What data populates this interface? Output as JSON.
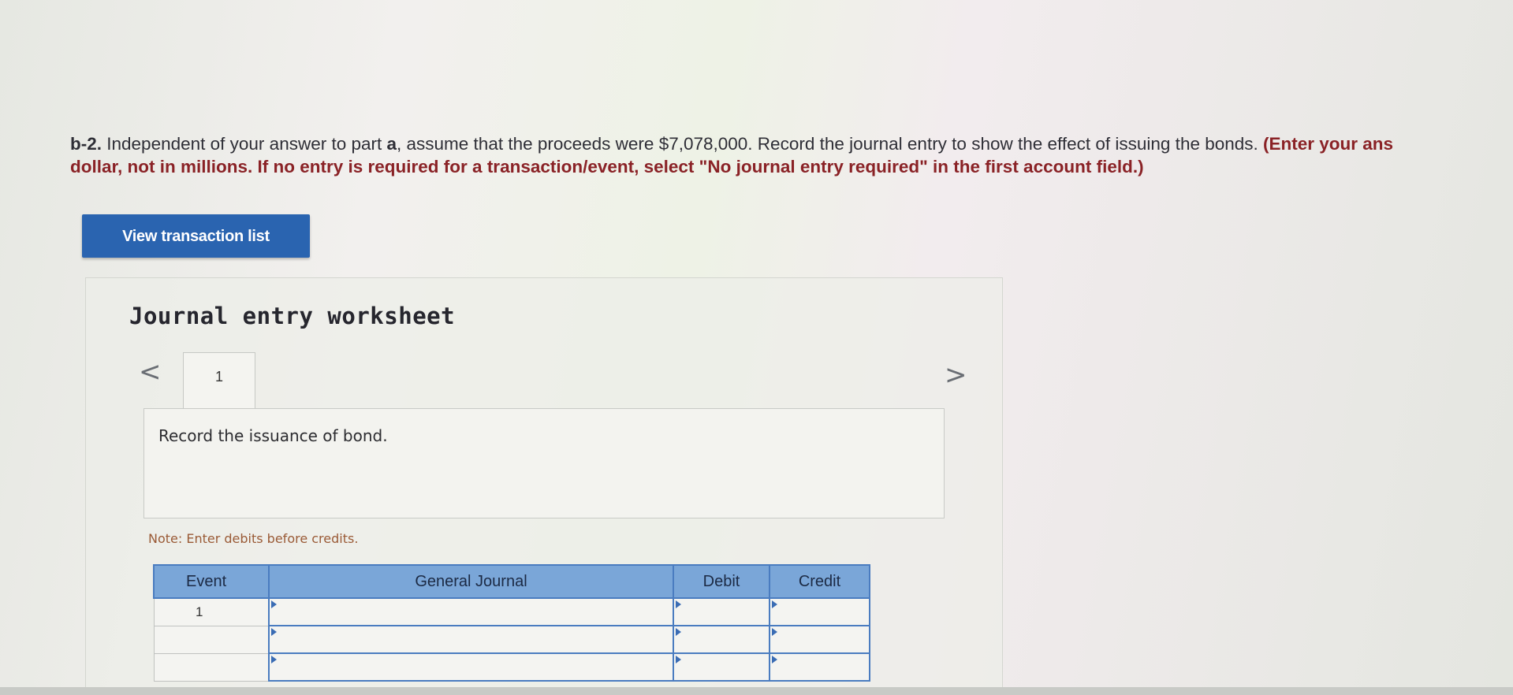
{
  "question": {
    "part": "b-2.",
    "text_1": " Independent of your answer to part ",
    "part_ref": "a",
    "text_2": ", assume that the proceeds were $7,078,000. Record the journal entry to show the effect of issuing the bonds. ",
    "instruction_1": "(Enter your ans",
    "instruction_2": "dollar, not in millions. If no entry is required for a transaction/event, select \"No journal entry required\" in the first account field.)"
  },
  "view_transaction_button": "View transaction list",
  "worksheet": {
    "title": "Journal entry worksheet",
    "prev_icon": "chevron-left-icon",
    "next_icon": "chevron-right-icon",
    "prev_glyph": "<",
    "next_glyph": ">",
    "tabs": [
      {
        "label": "1"
      }
    ],
    "description": "Record the issuance of bond.",
    "note": "Note: Enter debits before credits."
  },
  "journal_table": {
    "headers": {
      "event": "Event",
      "general_journal": "General Journal",
      "debit": "Debit",
      "credit": "Credit"
    },
    "rows": [
      {
        "event": "1",
        "account": "",
        "debit": "",
        "credit": ""
      },
      {
        "event": "",
        "account": "",
        "debit": "",
        "credit": ""
      },
      {
        "event": "",
        "account": "",
        "debit": "",
        "credit": ""
      }
    ]
  },
  "colors": {
    "button_blue": "#2a64b0",
    "header_blue": "#7aa6d8",
    "border_blue": "#4a7cc0",
    "instruction_red": "#8a2226",
    "note_brown": "#9a5a36"
  }
}
